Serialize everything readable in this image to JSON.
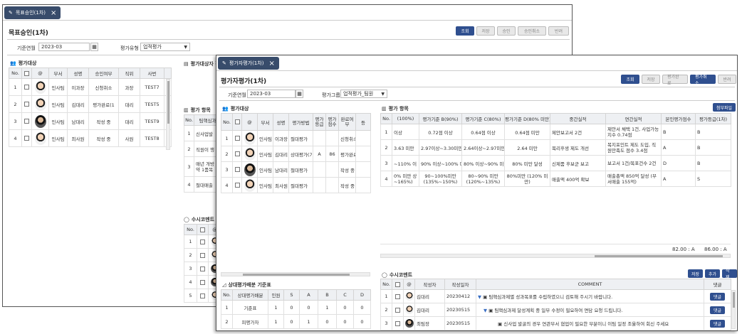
{
  "w1": {
    "tab_label": "목표승인(1차)",
    "title": "목표승인(1차)",
    "buttons": [
      "조회",
      "저장",
      "승인",
      "승인취소",
      "반려"
    ],
    "year_label": "기준연월",
    "year_value": "2023-03",
    "type_label": "평가유형",
    "type_value": "업적평가",
    "targets_title": "평가대상",
    "targets_headers": [
      "No.",
      "",
      "@",
      "부서",
      "성명",
      "승인여부",
      "직위",
      "사번"
    ],
    "targets_rows": [
      [
        "1",
        "",
        "",
        "인사팀",
        "이과장",
        "신청취소",
        "과장",
        "TEST7"
      ],
      [
        "2",
        "",
        "",
        "인사팀",
        "김대리",
        "평가완료(1",
        "대리",
        "TEST5"
      ],
      [
        "3",
        "",
        "",
        "인사팀",
        "남대리",
        "작성 중",
        "대리",
        "TEST9"
      ],
      [
        "4",
        "",
        "",
        "인사팀",
        "최사원",
        "작성 중",
        "사원",
        "TEST8"
      ]
    ],
    "info_title": "평가대상자 정",
    "items_title": "평가 항목",
    "items_headers": [
      "No.",
      "팀핵심과"
    ],
    "items_rows": [
      [
        "1",
        "신사업발"
      ],
      [
        "2",
        "직원이 행"
      ],
      [
        "3",
        "매년 개방 약 1품목"
      ],
      [
        "4",
        "절대매출"
      ]
    ],
    "comment_title": "수시코멘트",
    "comment_headers": [
      "No.",
      "",
      "@"
    ],
    "comment_rows": [
      "1",
      "2",
      "3",
      "4",
      "5"
    ]
  },
  "w2": {
    "tab_label": "평가자평가(1차)",
    "title": "평가자평가(1차)",
    "buttons": [
      "조회",
      "저장",
      "평가완료",
      "평가취소",
      "반려"
    ],
    "year_label": "기준연월",
    "year_value": "2023-03",
    "group_label": "평가그룹",
    "group_value": "업적평가_팀원",
    "targets_title": "평가대상",
    "targets_headers": [
      "No.",
      "",
      "@",
      "부서",
      "성명",
      "평가방법",
      "평가등급",
      "평가점수",
      "완료여부",
      "등"
    ],
    "targets_rows": [
      [
        "1",
        "",
        "",
        "인사팀",
        "이과장",
        "절대평가",
        "",
        "",
        "신청취소"
      ],
      [
        "2",
        "",
        "",
        "인사팀",
        "김대리",
        "상대평가(기?",
        "A",
        "86",
        "평가완료"
      ],
      [
        "3",
        "",
        "",
        "인사팀",
        "남대리",
        "절대평가",
        "",
        "",
        "작성 중"
      ],
      [
        "4",
        "",
        "",
        "인사팀",
        "최사원",
        "절대평가",
        "",
        "",
        "작성 중"
      ]
    ],
    "dist_title": "상대평가배분 기준표",
    "dist_headers": [
      "No.",
      "상대평가배분",
      "인원",
      "S",
      "A",
      "B",
      "C",
      "D"
    ],
    "dist_rows": [
      [
        "1",
        "기준표",
        "1",
        "0",
        "0",
        "1",
        "0",
        "0"
      ],
      [
        "2",
        "피평가자",
        "1",
        "0",
        "1",
        "0",
        "0",
        "0"
      ]
    ],
    "items_title": "평가 항목",
    "attach_button": "첨부파일",
    "items_headers": [
      "No.",
      "(100%)",
      "평가기준 B(90%)",
      "평가기준 C(80%)",
      "평가기준 D(80% 미만)",
      "중간실적",
      "연간실적",
      "본인평가점수",
      "평가등급(1차)"
    ],
    "items_rows": [
      [
        "1",
        "이상",
        "0.72점 이상",
        "0.64점 이상",
        "0.64점 미만",
        "제안보고서 2건",
        "제안서 채택 1건, 사업가능지수 0.74점",
        "B",
        "B"
      ],
      [
        "2",
        "3.63 미만",
        "2.97이상~3.30미만",
        "2.64이상~2.97미만",
        "2.64 미만",
        "복리후생 제도 개선",
        "복지포인트 제도 도입, 직원만족도 점수 3.4점",
        "A",
        "B"
      ],
      [
        "3",
        "~110% 이",
        "90% 이상~100% 미만",
        "80% 이상~90% 미만",
        "80% 미만 달성",
        "신제품 후보군 보고",
        "보고서 1건/목표건수 2건",
        "D",
        "B"
      ],
      [
        "4",
        "0% 미만 상~165%)",
        "90~100%미만 (135%~150%)",
        "80~90% 미만 (120%~135%)",
        "80%미만 (120% 미만)",
        "매출액 400억 확보",
        "매출총액 850억 달성 (부서매출 155억)",
        "A",
        "S"
      ]
    ],
    "totals": [
      "82.00 : A",
      "86.00 : A"
    ],
    "comment_title": "수시코멘트",
    "comment_buttons": [
      "저장",
      "추가",
      "삭제"
    ],
    "comment_headers": [
      "No.",
      "",
      "@",
      "작성자",
      "작성일자",
      "COMMENT",
      "댓글"
    ],
    "comment_rows": [
      [
        "1",
        "",
        "",
        "김대리",
        "20230412",
        "팀핵심과제별 성과목표를 수립하였으니 검토해 주시기 바랍니다.",
        "댓글"
      ],
      [
        "2",
        "",
        "",
        "김대리",
        "20230515",
        "팀핵심과제 달성계획 중 일부 수정이 필요하여 면담 요청 드립니다.",
        "댓글"
      ],
      [
        "3",
        "",
        "",
        "최팀장",
        "20230515",
        "신사업 발굴의 경우 연관부서 협업이 필요한 부분이니 이팀 일정 조율하여 회신 주세요",
        "댓글"
      ]
    ]
  }
}
